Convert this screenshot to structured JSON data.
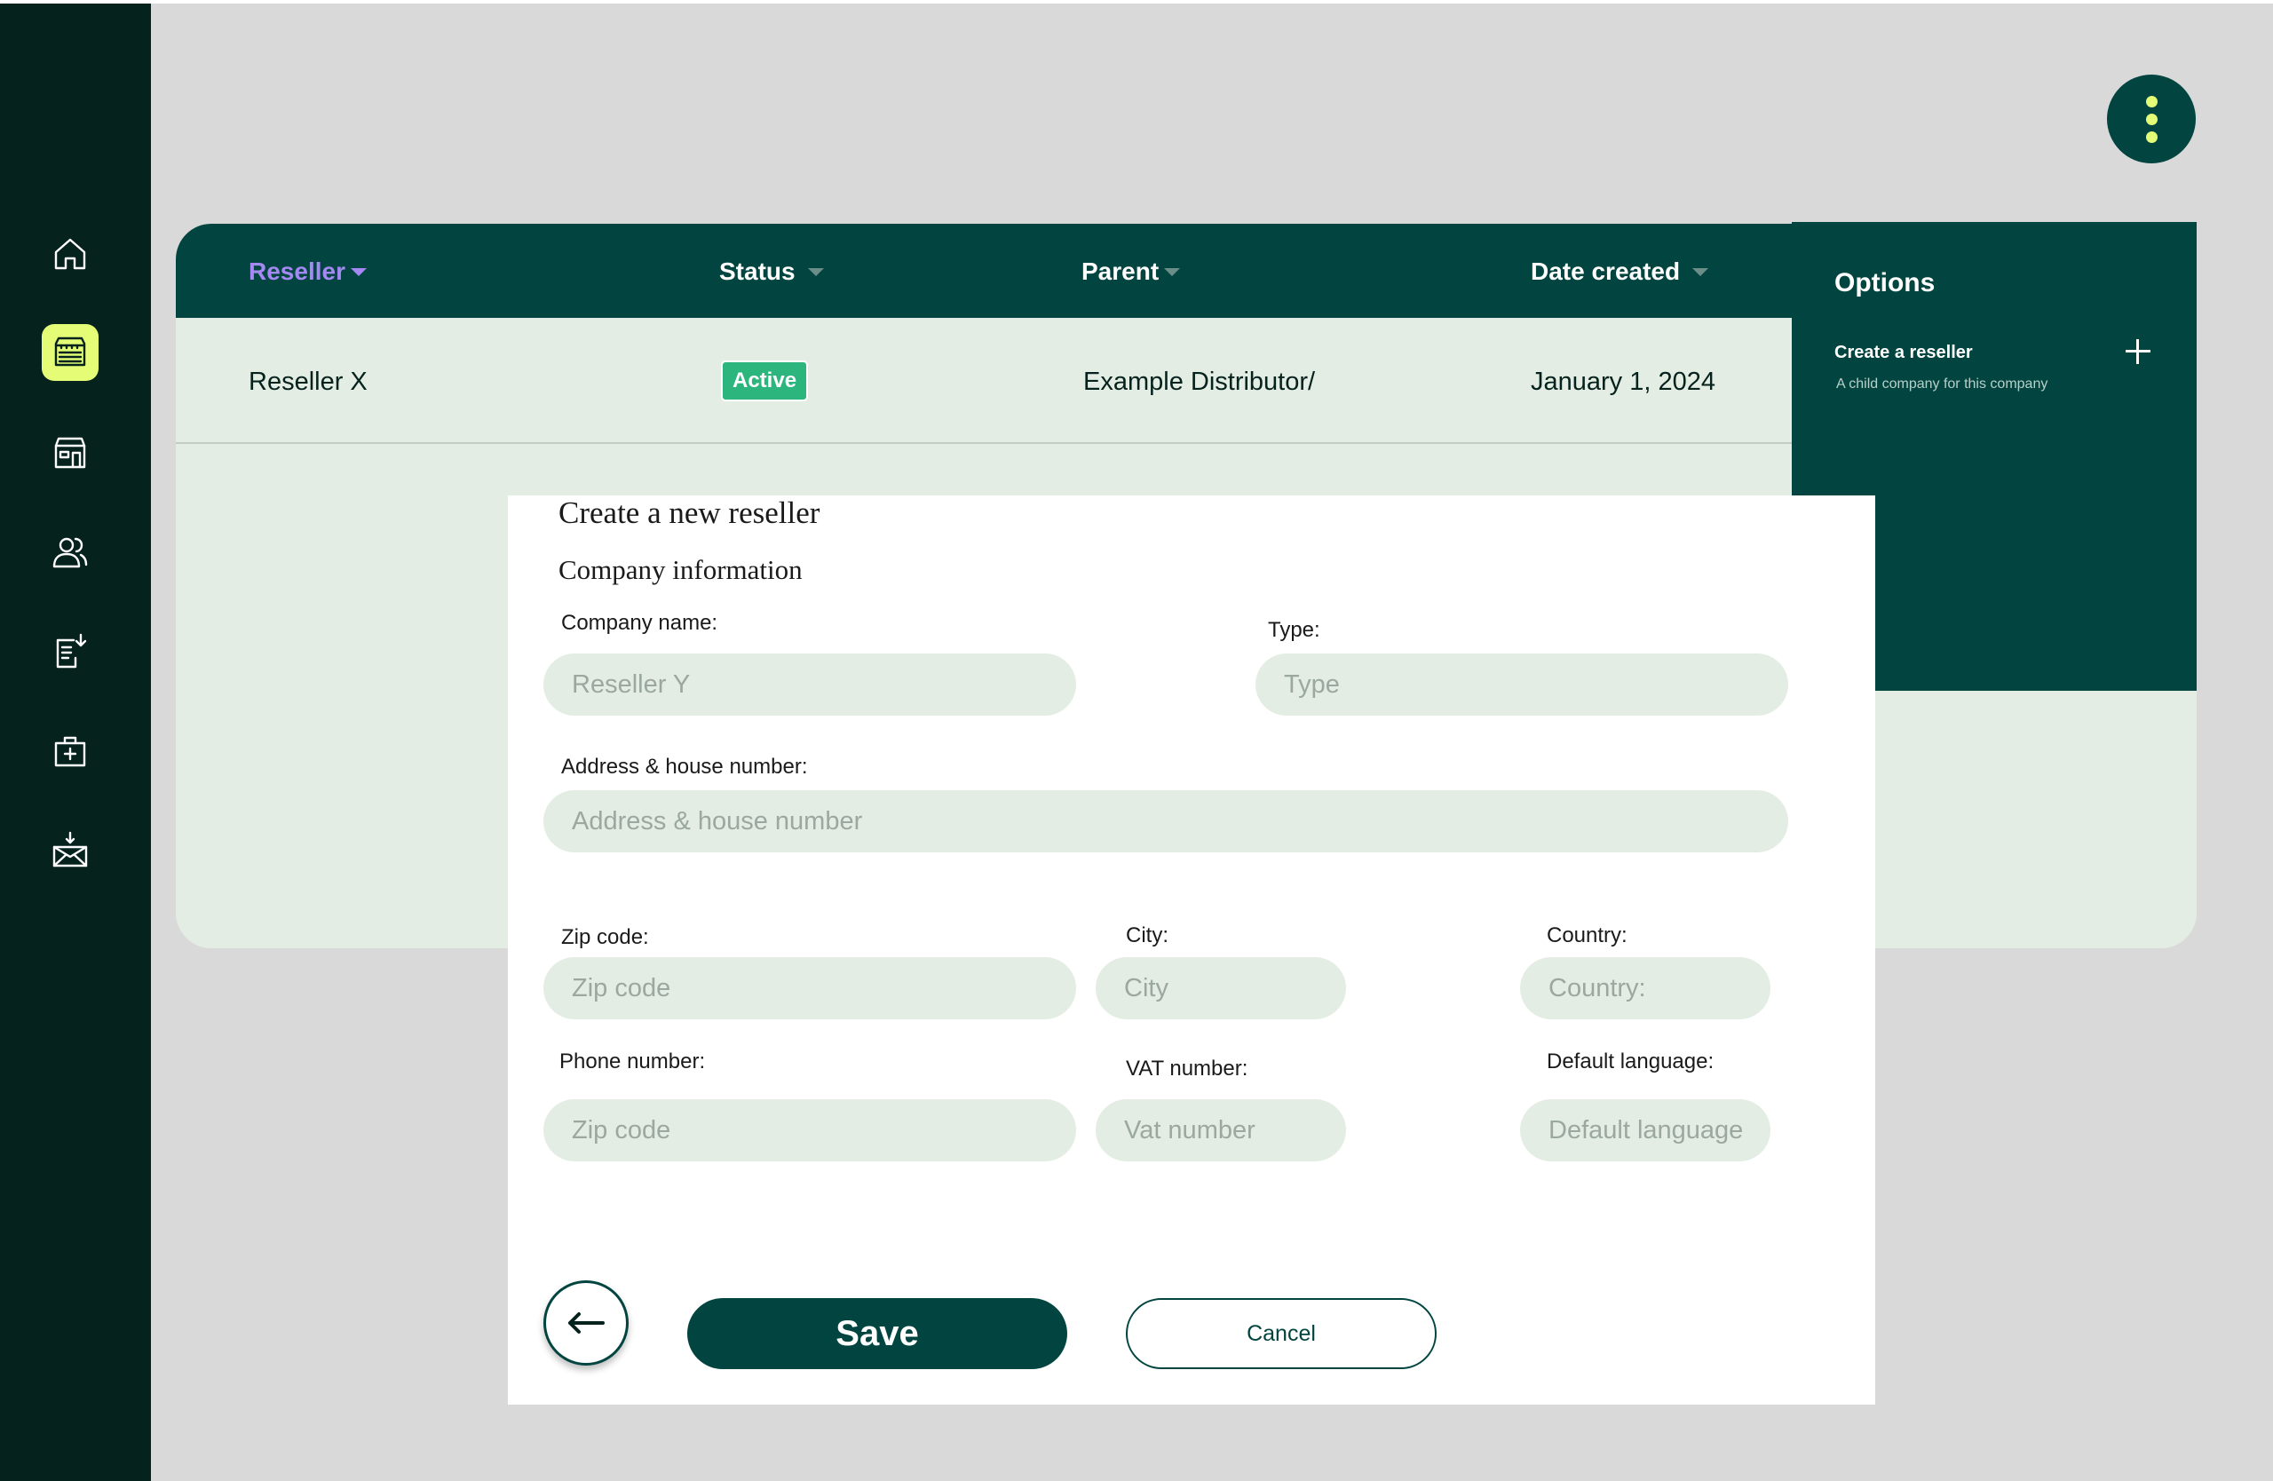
{
  "sidebar": {
    "items": [
      {
        "icon": "home-icon",
        "active": false
      },
      {
        "icon": "reseller-shop-icon",
        "active": true
      },
      {
        "icon": "store-icon",
        "active": false
      },
      {
        "icon": "users-icon",
        "active": false
      },
      {
        "icon": "document-import-icon",
        "active": false
      },
      {
        "icon": "medical-kit-icon",
        "active": false
      },
      {
        "icon": "mail-incoming-icon",
        "active": false
      }
    ]
  },
  "table": {
    "columns": [
      "Reseller",
      "Status",
      "Parent",
      "Date created"
    ],
    "rows": [
      {
        "reseller": "Reseller X",
        "status": "Active",
        "parent": "Example Distributor/",
        "date": "January 1, 2024"
      }
    ]
  },
  "options": {
    "title": "Options",
    "item_label": "Create a reseller",
    "item_sub": "A child company for this company"
  },
  "modal": {
    "title": "Create a new reseller",
    "section": "Company information",
    "fields": {
      "company_name": {
        "label": "Company name:",
        "placeholder": "Reseller Y"
      },
      "type": {
        "label": "Type:",
        "placeholder": "Type"
      },
      "address": {
        "label": "Address & house number:",
        "placeholder": "Address & house number"
      },
      "zip": {
        "label": "Zip code:",
        "placeholder": "Zip code"
      },
      "city": {
        "label": "City:",
        "placeholder": "City"
      },
      "country": {
        "label": "Country:",
        "placeholder": "Country:"
      },
      "phone": {
        "label": "Phone number:",
        "placeholder": "Zip code"
      },
      "vat": {
        "label": "VAT number:",
        "placeholder": "Vat number"
      },
      "language": {
        "label": "Default language:",
        "placeholder": "Default language"
      }
    },
    "save_label": "Save",
    "cancel_label": "Cancel"
  },
  "colors": {
    "sidebar": "#06221d",
    "primary": "#024540",
    "accent": "#e4fc76",
    "sort_active": "#a489f2",
    "badge_active": "#2cb67d",
    "input_bg": "#e4ede4"
  }
}
